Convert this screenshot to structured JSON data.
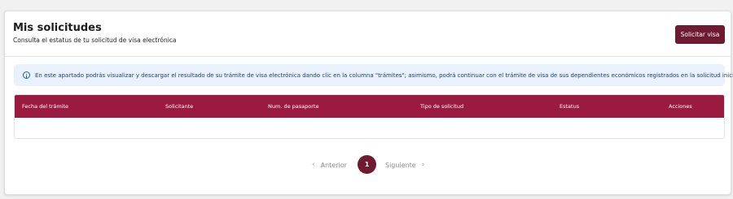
{
  "header": {
    "title": "Mis solicitudes",
    "subtitle": "Consulta el estatus de tu solicitud de visa electrónica",
    "primary_button": "Solicitar visa"
  },
  "info_alert": {
    "icon": "info-icon",
    "text": "En este apartado podrás visualizar y descargar el resultado de su trámite de visa electrónica dando clic en la columna \"trámites\"; asimismo, podrá continuar con el trámite de visa de sus dependientes económicos registrados en la solicitud inicial."
  },
  "table": {
    "columns": [
      "Fecha del trámite",
      "Solicitante",
      "Num. de pasaporte",
      "Tipo de solicitud",
      "Estatus",
      "Acciones"
    ],
    "rows": []
  },
  "pagination": {
    "previous": "Anterior",
    "next": "Siguiente",
    "current_page": "1"
  },
  "colors": {
    "brand_dark": "#6e1a31",
    "table_header": "#9b1b40",
    "alert_background": "#e9f1fc"
  }
}
